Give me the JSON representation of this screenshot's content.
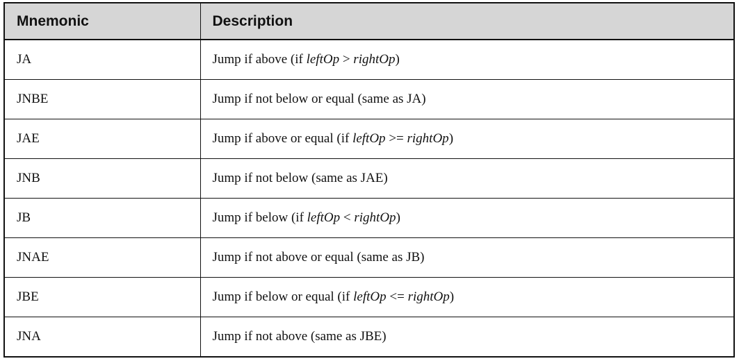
{
  "table": {
    "headers": {
      "mnemonic": "Mnemonic",
      "description": "Description"
    },
    "rows": [
      {
        "mnemonic": "JA",
        "parts": [
          "Jump if above (if ",
          "leftOp",
          " > ",
          "rightOp",
          ")"
        ]
      },
      {
        "mnemonic": "JNBE",
        "parts": [
          "Jump if not below or equal (same as JA)",
          "",
          "",
          "",
          ""
        ]
      },
      {
        "mnemonic": "JAE",
        "parts": [
          "Jump if above or equal (if ",
          "leftOp",
          " >= ",
          "rightOp",
          ")"
        ]
      },
      {
        "mnemonic": "JNB",
        "parts": [
          "Jump if not below (same as JAE)",
          "",
          "",
          "",
          ""
        ]
      },
      {
        "mnemonic": "JB",
        "parts": [
          "Jump if below (if ",
          "leftOp",
          " < ",
          "rightOp",
          ")"
        ]
      },
      {
        "mnemonic": "JNAE",
        "parts": [
          "Jump if not above or equal (same as JB)",
          "",
          "",
          "",
          ""
        ]
      },
      {
        "mnemonic": "JBE",
        "parts": [
          "Jump if below or equal (if ",
          "leftOp",
          " <= ",
          "rightOp",
          ")"
        ]
      },
      {
        "mnemonic": "JNA",
        "parts": [
          "Jump if not above (same as JBE)",
          "",
          "",
          "",
          ""
        ]
      }
    ]
  }
}
